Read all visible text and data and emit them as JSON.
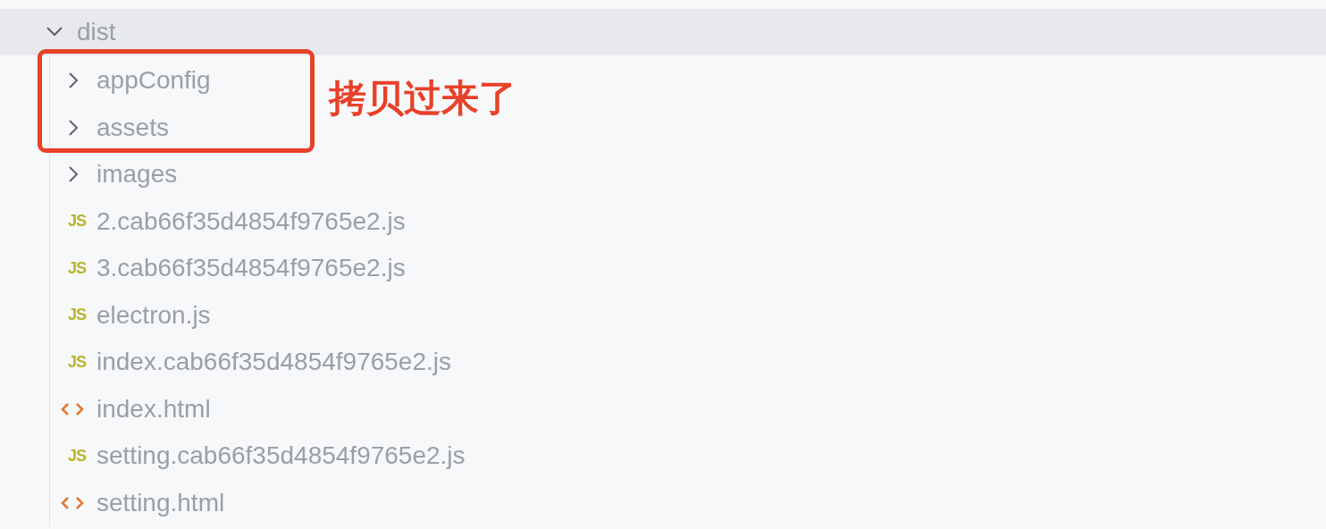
{
  "tree": {
    "label": "dist",
    "expanded": true,
    "selected": true,
    "children": [
      {
        "kind": "folder",
        "label": "appConfig",
        "expanded": false,
        "selected": false
      },
      {
        "kind": "folder",
        "label": "assets",
        "expanded": false,
        "selected": false
      },
      {
        "kind": "folder",
        "label": "images",
        "expanded": false,
        "selected": false
      },
      {
        "kind": "js",
        "icon_label": "JS",
        "label": "2.cab66f35d4854f9765e2.js",
        "selected": false
      },
      {
        "kind": "js",
        "icon_label": "JS",
        "label": "3.cab66f35d4854f9765e2.js",
        "selected": false
      },
      {
        "kind": "js",
        "icon_label": "JS",
        "label": "electron.js",
        "selected": false
      },
      {
        "kind": "js",
        "icon_label": "JS",
        "label": "index.cab66f35d4854f9765e2.js",
        "selected": false
      },
      {
        "kind": "html",
        "label": "index.html",
        "selected": false
      },
      {
        "kind": "js",
        "icon_label": "JS",
        "label": "setting.cab66f35d4854f9765e2.js",
        "selected": false
      },
      {
        "kind": "html",
        "label": "setting.html",
        "selected": false
      }
    ]
  },
  "annotation": {
    "text": "拷贝过来了"
  }
}
